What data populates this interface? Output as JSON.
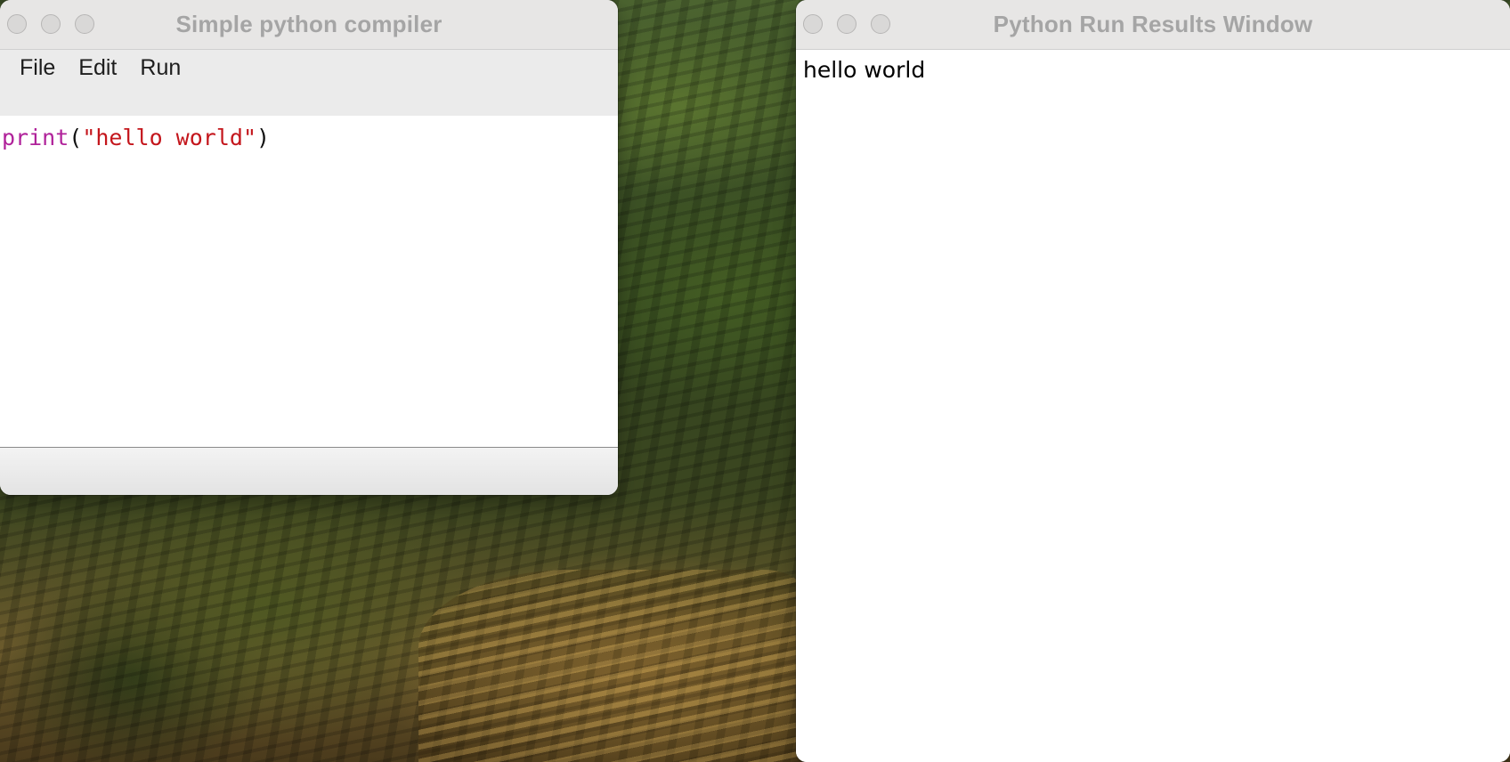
{
  "compiler_window": {
    "title": "Simple python compiler",
    "menu": [
      "File",
      "Edit",
      "Run"
    ],
    "code": {
      "function": "print",
      "open_paren": "(",
      "string": "\"hello world\"",
      "close_paren": ")"
    }
  },
  "results_window": {
    "title": "Python Run Results Window",
    "output": "hello world"
  },
  "colors": {
    "keyword": "#b0229a",
    "string": "#c4161c",
    "title_text": "#a5a5a5"
  }
}
